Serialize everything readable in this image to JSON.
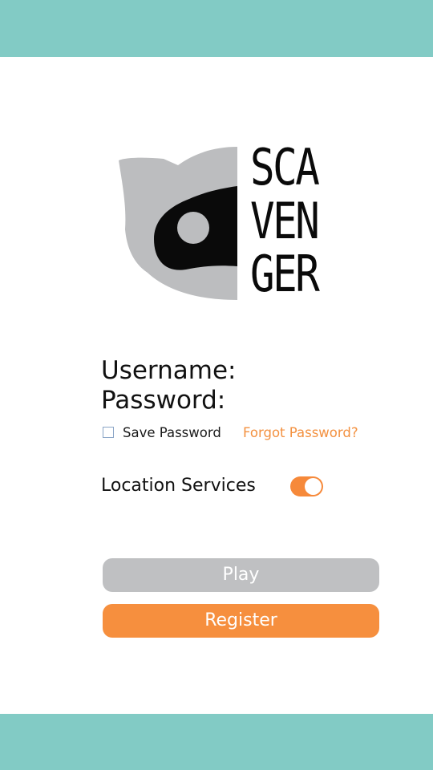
{
  "logo": {
    "line1": "SCA",
    "line2": "VEN",
    "line3": "GER"
  },
  "form": {
    "username_label": "Username:",
    "password_label": "Password:",
    "save_password_label": "Save Password",
    "forgot_password_label": "Forgot Password?",
    "location_services_label": "Location Services",
    "location_services_on": true
  },
  "buttons": {
    "play_label": "Play",
    "register_label": "Register"
  },
  "colors": {
    "bar": "#82cbc5",
    "accent": "#f68f3e",
    "button_gray": "#bfc0c2"
  }
}
